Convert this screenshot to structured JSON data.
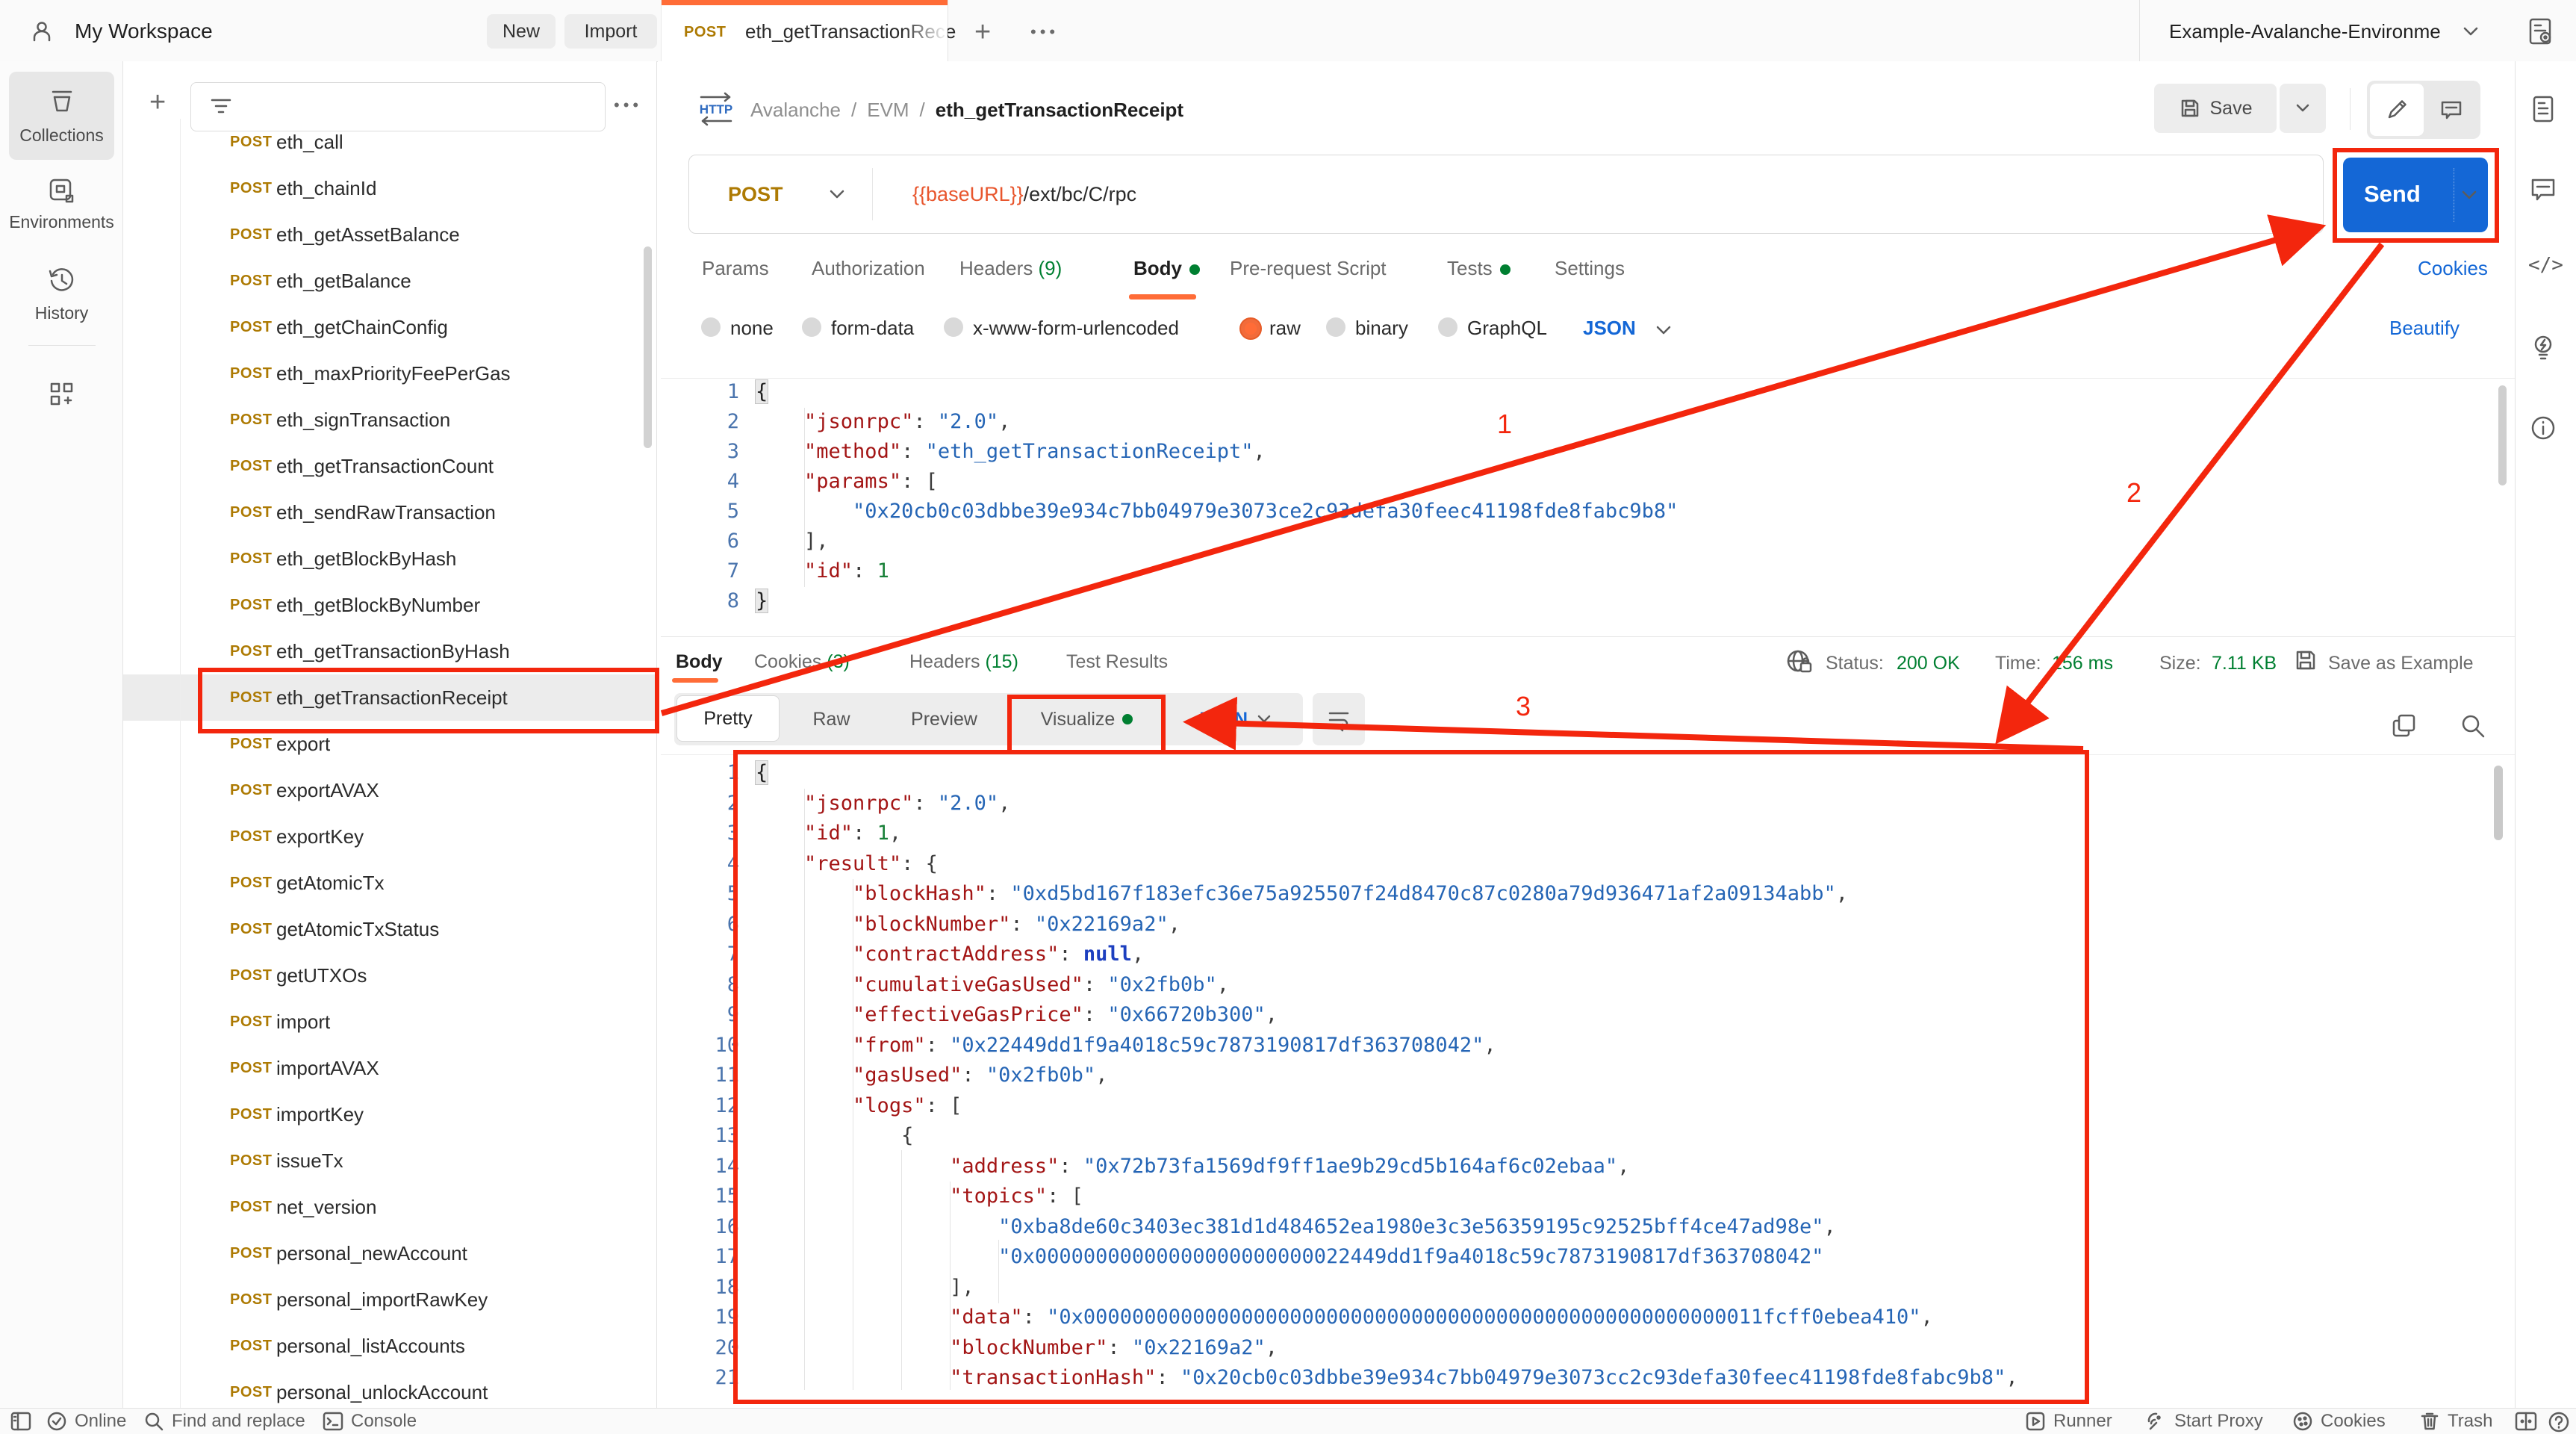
{
  "colors": {
    "accent": "#ff6c37",
    "blue": "#1467d6",
    "green": "#007f31",
    "annotation_red": "#f3260d",
    "method_gold": "#ad7a03"
  },
  "header": {
    "workspace": "My Workspace",
    "new_button": "New",
    "import_button": "Import",
    "tab": {
      "method": "POST",
      "title": "eth_getTransactionRece"
    },
    "plus": "+",
    "more": "•••",
    "environment": {
      "name": "Example-Avalanche-Environme"
    }
  },
  "left_rail": {
    "items": [
      {
        "label": "Collections"
      },
      {
        "label": "Environments"
      },
      {
        "label": "History"
      }
    ]
  },
  "sidebar": {
    "selected_index": 12,
    "items": [
      {
        "method": "POST",
        "name": "eth_call"
      },
      {
        "method": "POST",
        "name": "eth_chainId"
      },
      {
        "method": "POST",
        "name": "eth_getAssetBalance"
      },
      {
        "method": "POST",
        "name": "eth_getBalance"
      },
      {
        "method": "POST",
        "name": "eth_getChainConfig"
      },
      {
        "method": "POST",
        "name": "eth_maxPriorityFeePerGas"
      },
      {
        "method": "POST",
        "name": "eth_signTransaction"
      },
      {
        "method": "POST",
        "name": "eth_getTransactionCount"
      },
      {
        "method": "POST",
        "name": "eth_sendRawTransaction"
      },
      {
        "method": "POST",
        "name": "eth_getBlockByHash"
      },
      {
        "method": "POST",
        "name": "eth_getBlockByNumber"
      },
      {
        "method": "POST",
        "name": "eth_getTransactionByHash"
      },
      {
        "method": "POST",
        "name": "eth_getTransactionReceipt"
      },
      {
        "method": "POST",
        "name": "export"
      },
      {
        "method": "POST",
        "name": "exportAVAX"
      },
      {
        "method": "POST",
        "name": "exportKey"
      },
      {
        "method": "POST",
        "name": "getAtomicTx"
      },
      {
        "method": "POST",
        "name": "getAtomicTxStatus"
      },
      {
        "method": "POST",
        "name": "getUTXOs"
      },
      {
        "method": "POST",
        "name": "import"
      },
      {
        "method": "POST",
        "name": "importAVAX"
      },
      {
        "method": "POST",
        "name": "importKey"
      },
      {
        "method": "POST",
        "name": "issueTx"
      },
      {
        "method": "POST",
        "name": "net_version"
      },
      {
        "method": "POST",
        "name": "personal_newAccount"
      },
      {
        "method": "POST",
        "name": "personal_importRawKey"
      },
      {
        "method": "POST",
        "name": "personal_listAccounts"
      },
      {
        "method": "POST",
        "name": "personal_unlockAccount"
      }
    ]
  },
  "request": {
    "breadcrumb": {
      "root": "Avalanche",
      "sep": "/",
      "folder": "EVM",
      "current": "eth_getTransactionReceipt"
    },
    "save_label": "Save",
    "send_label": "Send",
    "method": "POST",
    "url_variable": "{{baseURL}}",
    "url_path": "/ext/bc/C/rpc",
    "tabs": [
      {
        "label": "Params"
      },
      {
        "label": "Authorization"
      },
      {
        "label": "Headers",
        "count": "(9)"
      },
      {
        "label": "Body",
        "dot": true,
        "active": true
      },
      {
        "label": "Pre-request Script"
      },
      {
        "label": "Tests",
        "dot": true
      },
      {
        "label": "Settings"
      }
    ],
    "cookies_link": "Cookies",
    "beautify_link": "Beautify",
    "body_modes": [
      {
        "label": "none"
      },
      {
        "label": "form-data"
      },
      {
        "label": "x-www-form-urlencoded"
      },
      {
        "label": "raw",
        "selected": true
      },
      {
        "label": "binary"
      },
      {
        "label": "GraphQL"
      }
    ],
    "language": "JSON",
    "code": [
      [
        [
          "m",
          "{"
        ]
      ],
      [
        [
          "p",
          "    "
        ],
        [
          "k",
          "\"jsonrpc\""
        ],
        [
          "p",
          ": "
        ],
        [
          "s",
          "\"2.0\""
        ],
        [
          "p",
          ","
        ]
      ],
      [
        [
          "p",
          "    "
        ],
        [
          "k",
          "\"method\""
        ],
        [
          "p",
          ": "
        ],
        [
          "s",
          "\"eth_getTransactionReceipt\""
        ],
        [
          "p",
          ","
        ]
      ],
      [
        [
          "p",
          "    "
        ],
        [
          "k",
          "\"params\""
        ],
        [
          "p",
          ": ["
        ]
      ],
      [
        [
          "p",
          "        "
        ],
        [
          "s",
          "\"0x20cb0c03dbbe39e934c7bb04979e3073ce2c93defa30feec41198fde8fabc9b8\""
        ]
      ],
      [
        [
          "p",
          "    ],"
        ]
      ],
      [
        [
          "p",
          "    "
        ],
        [
          "k",
          "\"id\""
        ],
        [
          "p",
          ": "
        ],
        [
          "n",
          "1"
        ]
      ],
      [
        [
          "m",
          "}"
        ]
      ]
    ]
  },
  "response": {
    "tabs": [
      {
        "label": "Body",
        "active": true
      },
      {
        "label": "Cookies",
        "count": "(3)"
      },
      {
        "label": "Headers",
        "count": "(15)"
      },
      {
        "label": "Test Results"
      }
    ],
    "status_label": "Status:",
    "status_value": "200 OK",
    "time_label": "Time:",
    "time_value": "156 ms",
    "size_label": "Size:",
    "size_value": "7.11 KB",
    "save_as_example": "Save as Example",
    "more": "•••",
    "views": [
      {
        "label": "Pretty",
        "active": true
      },
      {
        "label": "Raw"
      },
      {
        "label": "Preview"
      },
      {
        "label": "Visualize",
        "dot": true
      }
    ],
    "language": "JSON",
    "code": [
      [
        [
          "m",
          "{"
        ]
      ],
      [
        [
          "p",
          "    "
        ],
        [
          "k",
          "\"jsonrpc\""
        ],
        [
          "p",
          ": "
        ],
        [
          "s",
          "\"2.0\""
        ],
        [
          "p",
          ","
        ]
      ],
      [
        [
          "p",
          "    "
        ],
        [
          "k",
          "\"id\""
        ],
        [
          "p",
          ": "
        ],
        [
          "n",
          "1"
        ],
        [
          "p",
          ","
        ]
      ],
      [
        [
          "p",
          "    "
        ],
        [
          "k",
          "\"result\""
        ],
        [
          "p",
          ": {"
        ]
      ],
      [
        [
          "p",
          "        "
        ],
        [
          "k",
          "\"blockHash\""
        ],
        [
          "p",
          ": "
        ],
        [
          "s",
          "\"0xd5bd167f183efc36e75a925507f24d8470c87c0280a79d936471af2a09134abb\""
        ],
        [
          "p",
          ","
        ]
      ],
      [
        [
          "p",
          "        "
        ],
        [
          "k",
          "\"blockNumber\""
        ],
        [
          "p",
          ": "
        ],
        [
          "s",
          "\"0x22169a2\""
        ],
        [
          "p",
          ","
        ]
      ],
      [
        [
          "p",
          "        "
        ],
        [
          "k",
          "\"contractAddress\""
        ],
        [
          "p",
          ": "
        ],
        [
          "u",
          "null"
        ],
        [
          "p",
          ","
        ]
      ],
      [
        [
          "p",
          "        "
        ],
        [
          "k",
          "\"cumulativeGasUsed\""
        ],
        [
          "p",
          ": "
        ],
        [
          "s",
          "\"0x2fb0b\""
        ],
        [
          "p",
          ","
        ]
      ],
      [
        [
          "p",
          "        "
        ],
        [
          "k",
          "\"effectiveGasPrice\""
        ],
        [
          "p",
          ": "
        ],
        [
          "s",
          "\"0x66720b300\""
        ],
        [
          "p",
          ","
        ]
      ],
      [
        [
          "p",
          "        "
        ],
        [
          "k",
          "\"from\""
        ],
        [
          "p",
          ": "
        ],
        [
          "s",
          "\"0x22449dd1f9a4018c59c7873190817df363708042\""
        ],
        [
          "p",
          ","
        ]
      ],
      [
        [
          "p",
          "        "
        ],
        [
          "k",
          "\"gasUsed\""
        ],
        [
          "p",
          ": "
        ],
        [
          "s",
          "\"0x2fb0b\""
        ],
        [
          "p",
          ","
        ]
      ],
      [
        [
          "p",
          "        "
        ],
        [
          "k",
          "\"logs\""
        ],
        [
          "p",
          ": ["
        ]
      ],
      [
        [
          "p",
          "            {"
        ]
      ],
      [
        [
          "p",
          "                "
        ],
        [
          "k",
          "\"address\""
        ],
        [
          "p",
          ": "
        ],
        [
          "s",
          "\"0x72b73fa1569df9ff1ae9b29cd5b164af6c02ebaa\""
        ],
        [
          "p",
          ","
        ]
      ],
      [
        [
          "p",
          "                "
        ],
        [
          "k",
          "\"topics\""
        ],
        [
          "p",
          ": ["
        ]
      ],
      [
        [
          "p",
          "                    "
        ],
        [
          "s",
          "\"0xba8de60c3403ec381d1d484652ea1980e3c3e56359195c92525bff4ce47ad98e\""
        ],
        [
          "p",
          ","
        ]
      ],
      [
        [
          "p",
          "                    "
        ],
        [
          "s",
          "\"0x00000000000000000000000022449dd1f9a4018c59c7873190817df363708042\""
        ]
      ],
      [
        [
          "p",
          "                ],"
        ]
      ],
      [
        [
          "p",
          "                "
        ],
        [
          "k",
          "\"data\""
        ],
        [
          "p",
          ": "
        ],
        [
          "s",
          "\"0x00000000000000000000000000000000000000000000000000000011fcff0ebea410\""
        ],
        [
          "p",
          ","
        ]
      ],
      [
        [
          "p",
          "                "
        ],
        [
          "k",
          "\"blockNumber\""
        ],
        [
          "p",
          ": "
        ],
        [
          "s",
          "\"0x22169a2\""
        ],
        [
          "p",
          ","
        ]
      ],
      [
        [
          "p",
          "                "
        ],
        [
          "k",
          "\"transactionHash\""
        ],
        [
          "p",
          ": "
        ],
        [
          "s",
          "\"0x20cb0c03dbbe39e934c7bb04979e3073cc2c93defa30feec41198fde8fabc9b8\""
        ],
        [
          "p",
          ","
        ]
      ]
    ]
  },
  "footer": {
    "online": "Online",
    "find": "Find and replace",
    "console": "Console",
    "runner": "Runner",
    "start_proxy": "Start Proxy",
    "cookies": "Cookies",
    "trash": "Trash"
  },
  "annotations": {
    "label_1": "1",
    "label_2": "2",
    "label_3": "3"
  }
}
